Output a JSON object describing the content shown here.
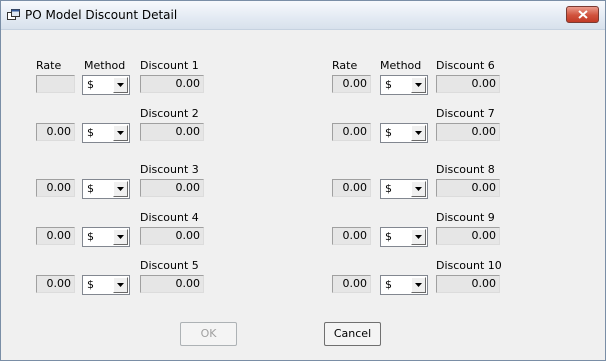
{
  "window": {
    "title": "PO Model Discount Detail"
  },
  "headers": {
    "rate": "Rate",
    "method": "Method"
  },
  "rows": [
    {
      "discount_label": "Discount 1",
      "rate": "",
      "method": "$",
      "amount": "0.00"
    },
    {
      "discount_label": "Discount 2",
      "rate": "0.00",
      "method": "$",
      "amount": "0.00"
    },
    {
      "discount_label": "Discount 3",
      "rate": "0.00",
      "method": "$",
      "amount": "0.00"
    },
    {
      "discount_label": "Discount 4",
      "rate": "0.00",
      "method": "$",
      "amount": "0.00"
    },
    {
      "discount_label": "Discount 5",
      "rate": "0.00",
      "method": "$",
      "amount": "0.00"
    },
    {
      "discount_label": "Discount 6",
      "rate": "0.00",
      "method": "$",
      "amount": "0.00"
    },
    {
      "discount_label": "Discount 7",
      "rate": "0.00",
      "method": "$",
      "amount": "0.00"
    },
    {
      "discount_label": "Discount 8",
      "rate": "0.00",
      "method": "$",
      "amount": "0.00"
    },
    {
      "discount_label": "Discount 9",
      "rate": "0.00",
      "method": "$",
      "amount": "0.00"
    },
    {
      "discount_label": "Discount 10",
      "rate": "0.00",
      "method": "$",
      "amount": "0.00"
    }
  ],
  "buttons": {
    "ok": "OK",
    "cancel": "Cancel"
  },
  "icons": {
    "app": "window-app-icon",
    "close": "close-icon",
    "dropdown": "chevron-down-icon"
  }
}
